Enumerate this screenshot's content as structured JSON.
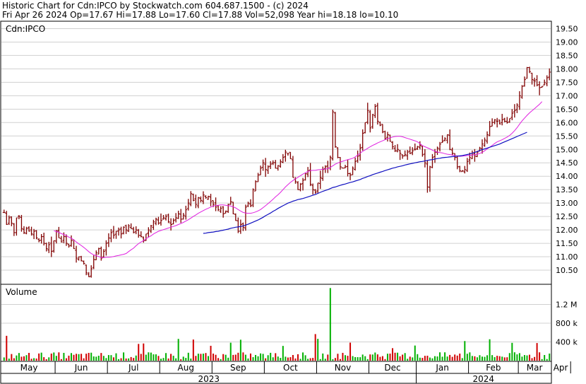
{
  "header": {
    "line1": "Historic Chart for Cdn:IPCO by Stockwatch.com 604.687.1500 - (c) 2024",
    "line2": "Fri Apr 26 2024   Op=17.67  Hi=17.88  Lo=17.60  Cl=17.88  Vol=52,098  Year hi=18.18  lo=10.10"
  },
  "chart_data": [
    {
      "type": "ohlc",
      "symbol": "Cdn:IPCO",
      "ylim": [
        10.0,
        19.75
      ],
      "ytick_labels": [
        "19.50",
        "19.00",
        "18.50",
        "18.00",
        "17.50",
        "17.00",
        "16.50",
        "16.00",
        "15.50",
        "15.00",
        "14.50",
        "14.00",
        "13.50",
        "13.00",
        "12.50",
        "12.00",
        "11.50",
        "11.00",
        "10.50"
      ],
      "grid": true,
      "colors": {
        "bars": "#800000",
        "ma_short": "#e020e0",
        "ma_long": "#1010c0"
      },
      "close": [
        12.65,
        12.2,
        12.45,
        12.25,
        11.9,
        12.45,
        12.5,
        12.05,
        11.9,
        12.05,
        11.95,
        11.85,
        11.95,
        11.7,
        11.6,
        11.75,
        11.5,
        11.3,
        11.45,
        11.2,
        11.6,
        11.95,
        11.7,
        11.55,
        11.75,
        11.5,
        11.4,
        11.6,
        11.3,
        10.95,
        11.0,
        10.85,
        10.75,
        10.4,
        10.25,
        10.55,
        10.9,
        11.15,
        11.3,
        10.95,
        11.2,
        11.5,
        11.7,
        11.9,
        11.8,
        11.95,
        12.0,
        11.85,
        12.1,
        12.0,
        12.15,
        12.05,
        11.9,
        12.0,
        11.8,
        11.75,
        11.6,
        11.85,
        12.0,
        12.15,
        12.3,
        12.4,
        12.25,
        12.35,
        12.45,
        12.5,
        12.3,
        12.2,
        12.35,
        12.45,
        12.6,
        12.4,
        12.55,
        12.75,
        13.0,
        13.35,
        13.1,
        12.95,
        13.2,
        13.1,
        13.3,
        13.2,
        13.25,
        13.05,
        12.95,
        12.85,
        12.75,
        12.8,
        12.6,
        12.7,
        12.95,
        13.05,
        12.6,
        12.35,
        11.95,
        12.2,
        12.1,
        12.85,
        13.0,
        12.9,
        13.5,
        13.8,
        14.05,
        14.3,
        14.5,
        14.25,
        14.35,
        14.45,
        14.5,
        14.3,
        14.4,
        14.55,
        14.7,
        14.9,
        14.85,
        14.65,
        13.95,
        13.8,
        13.5,
        13.7,
        13.85,
        14.1,
        14.2,
        13.7,
        13.5,
        13.4,
        13.75,
        13.95,
        14.25,
        14.35,
        14.3,
        14.7,
        16.4,
        15.1,
        14.7,
        14.35,
        14.3,
        14.35,
        14.1,
        14.05,
        14.3,
        14.55,
        14.75,
        15.05,
        15.6,
        16.0,
        16.45,
        15.8,
        16.3,
        16.6,
        16.05,
        15.9,
        15.65,
        15.4,
        15.55,
        15.3,
        15.1,
        14.95,
        15.0,
        14.85,
        14.75,
        14.8,
        14.9,
        14.85,
        14.95,
        15.0,
        15.1,
        15.15,
        14.8,
        14.5,
        13.6,
        14.35,
        14.7,
        14.9,
        15.05,
        15.2,
        15.3,
        15.4,
        15.55,
        15.0,
        14.85,
        14.7,
        14.35,
        14.2,
        14.2,
        14.25,
        14.55,
        14.7,
        14.8,
        14.75,
        14.9,
        15.05,
        15.2,
        15.35,
        15.55,
        15.85,
        16.0,
        16.1,
        16.05,
        15.95,
        16.1,
        16.05,
        16.0,
        16.15,
        16.35,
        16.45,
        16.65,
        17.0,
        17.35,
        17.6,
        18.05,
        17.9,
        17.6,
        17.55,
        17.4,
        17.3,
        17.35,
        17.5,
        17.67,
        17.88
      ],
      "ma_short": [
        null,
        null,
        null,
        null,
        null,
        null,
        null,
        null,
        null,
        null,
        null,
        null,
        null,
        null,
        null,
        null,
        null,
        null,
        null,
        null,
        11.97,
        11.94,
        11.91,
        11.86,
        11.83,
        11.79,
        11.73,
        11.69,
        11.63,
        11.55,
        11.48,
        11.42,
        11.35,
        11.27,
        11.19,
        11.12,
        11.07,
        11.04,
        11.01,
        10.97,
        10.97,
        10.98,
        10.98,
        10.99,
        11.01,
        11.03,
        11.05,
        11.07,
        11.09,
        11.12,
        11.19,
        11.26,
        11.32,
        11.41,
        11.49,
        11.55,
        11.6,
        11.67,
        11.73,
        11.78,
        11.85,
        11.9,
        11.95,
        11.98,
        12.01,
        12.04,
        12.07,
        12.1,
        12.13,
        12.16,
        12.2,
        12.24,
        12.28,
        12.33,
        12.38,
        12.44,
        12.5,
        12.56,
        12.62,
        12.67,
        12.72,
        12.77,
        12.81,
        12.85,
        12.89,
        12.91,
        12.92,
        12.93,
        12.93,
        12.92,
        12.9,
        12.89,
        12.86,
        12.82,
        12.76,
        12.7,
        12.65,
        12.63,
        12.62,
        12.62,
        12.64,
        12.67,
        12.71,
        12.76,
        12.83,
        12.9,
        12.98,
        13.06,
        13.14,
        13.23,
        13.31,
        13.4,
        13.5,
        13.6,
        13.69,
        13.77,
        13.84,
        13.9,
        13.96,
        14.02,
        14.08,
        14.13,
        14.18,
        14.21,
        14.22,
        14.22,
        14.24,
        14.25,
        14.26,
        14.27,
        14.28,
        14.33,
        14.39,
        14.45,
        14.49,
        14.53,
        14.56,
        14.59,
        14.62,
        14.64,
        14.67,
        14.72,
        14.79,
        14.86,
        14.93,
        14.98,
        15.04,
        15.1,
        15.15,
        15.19,
        15.24,
        15.28,
        15.32,
        15.36,
        15.4,
        15.43,
        15.46,
        15.48,
        15.49,
        15.49,
        15.47,
        15.44,
        15.41,
        15.38,
        15.35,
        15.32,
        15.28,
        15.22,
        15.14,
        15.1,
        15.06,
        15.02,
        14.97,
        14.93,
        14.9,
        14.88,
        14.87,
        14.84,
        14.82,
        14.81,
        14.79,
        14.77,
        14.75,
        14.74,
        14.75,
        14.76,
        14.77,
        14.78,
        14.79,
        14.8,
        14.82,
        14.85,
        14.89,
        14.95,
        15.02,
        15.08,
        15.15,
        15.22,
        15.28,
        15.32,
        15.36,
        15.41,
        15.46,
        15.52,
        15.6,
        15.7,
        15.81,
        15.94,
        16.06,
        16.17,
        16.27,
        16.36,
        16.44,
        16.52,
        16.6,
        16.68,
        16.78
      ],
      "ma_long": [
        null,
        null,
        null,
        null,
        null,
        null,
        null,
        null,
        null,
        null,
        null,
        null,
        null,
        null,
        null,
        null,
        null,
        null,
        null,
        null,
        null,
        null,
        null,
        null,
        null,
        null,
        null,
        null,
        null,
        null,
        null,
        null,
        null,
        null,
        null,
        null,
        null,
        null,
        null,
        null,
        null,
        null,
        null,
        null,
        null,
        null,
        null,
        null,
        null,
        null,
        null,
        null,
        null,
        null,
        null,
        null,
        null,
        null,
        null,
        null,
        null,
        null,
        null,
        null,
        null,
        null,
        null,
        null,
        null,
        null,
        null,
        null,
        null,
        null,
        null,
        null,
        null,
        null,
        null,
        null,
        11.87,
        11.88,
        11.9,
        11.91,
        11.92,
        11.94,
        11.95,
        11.97,
        11.99,
        12.01,
        12.03,
        12.06,
        12.08,
        12.1,
        12.11,
        12.13,
        12.15,
        12.18,
        12.21,
        12.25,
        12.29,
        12.33,
        12.37,
        12.42,
        12.47,
        12.53,
        12.58,
        12.63,
        12.69,
        12.74,
        12.8,
        12.85,
        12.9,
        12.95,
        13.0,
        13.03,
        13.07,
        13.1,
        13.13,
        13.15,
        13.17,
        13.2,
        13.23,
        13.26,
        13.29,
        13.32,
        13.36,
        13.4,
        13.44,
        13.47,
        13.5,
        13.54,
        13.58,
        13.6,
        13.63,
        13.66,
        13.69,
        13.71,
        13.74,
        13.77,
        13.79,
        13.82,
        13.85,
        13.88,
        13.92,
        13.95,
        13.99,
        14.02,
        14.06,
        14.09,
        14.12,
        14.15,
        14.18,
        14.21,
        14.24,
        14.27,
        14.3,
        14.32,
        14.35,
        14.37,
        14.39,
        14.42,
        14.44,
        14.46,
        14.48,
        14.5,
        14.52,
        14.54,
        14.55,
        14.57,
        14.59,
        14.61,
        14.62,
        14.64,
        14.66,
        14.67,
        14.69,
        14.7,
        14.71,
        14.72,
        14.73,
        14.74,
        14.75,
        14.76,
        14.77,
        14.79,
        14.81,
        14.83,
        14.86,
        14.89,
        14.92,
        14.96,
        14.99,
        15.02,
        15.05,
        15.08,
        15.11,
        15.14,
        15.17,
        15.2,
        15.24,
        15.28,
        15.32,
        15.36,
        15.4,
        15.44,
        15.48,
        15.52,
        15.56,
        15.6,
        15.64
      ]
    },
    {
      "type": "bar",
      "title": "Volume",
      "ytick_labels": [
        "1.2 M",
        "800 k",
        "400 k"
      ],
      "ylim": [
        0,
        1600000
      ],
      "colors": {
        "up": "#00b000",
        "down": "#d00000"
      },
      "x_months": [
        "May",
        "Jun",
        "Jul",
        "Aug",
        "Sep",
        "Oct",
        "Nov",
        "Dec",
        "Jan",
        "Feb",
        "Mar",
        "Apr"
      ],
      "x_years": [
        "2023",
        "2024"
      ],
      "spikes": [
        {
          "index": 131,
          "value": 1550000
        }
      ]
    }
  ]
}
